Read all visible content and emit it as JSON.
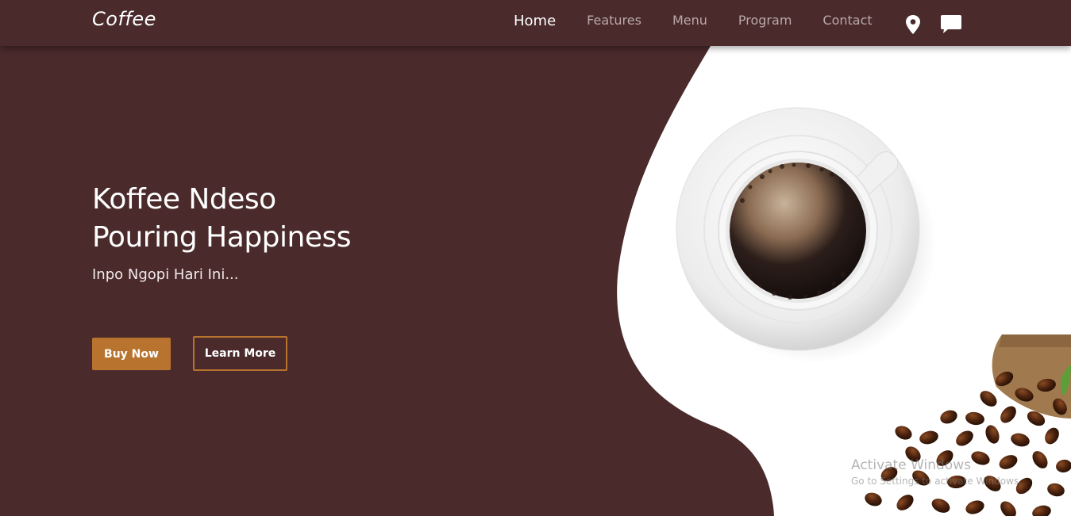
{
  "nav": {
    "brand": "Coffee",
    "links": [
      {
        "label": "Home",
        "active": true
      },
      {
        "label": "Features",
        "active": false
      },
      {
        "label": "Menu",
        "active": false
      },
      {
        "label": "Program",
        "active": false
      },
      {
        "label": "Contact",
        "active": false
      }
    ],
    "icons": [
      "location-pin-icon",
      "chat-bubble-icon"
    ]
  },
  "hero": {
    "title_line1": "Koffee Ndeso",
    "title_line2": "Pouring Happiness",
    "subtitle": "Inpo Ngopi Hari Ini...",
    "buy_label": "Buy Now",
    "learn_label": "Learn More"
  },
  "watermark": {
    "title": "Activate Windows",
    "subtitle": "Go to Settings to activate Windows."
  },
  "colors": {
    "background": "#4a2a2b",
    "accent": "#b8742f",
    "white_panel": "#ffffff"
  }
}
